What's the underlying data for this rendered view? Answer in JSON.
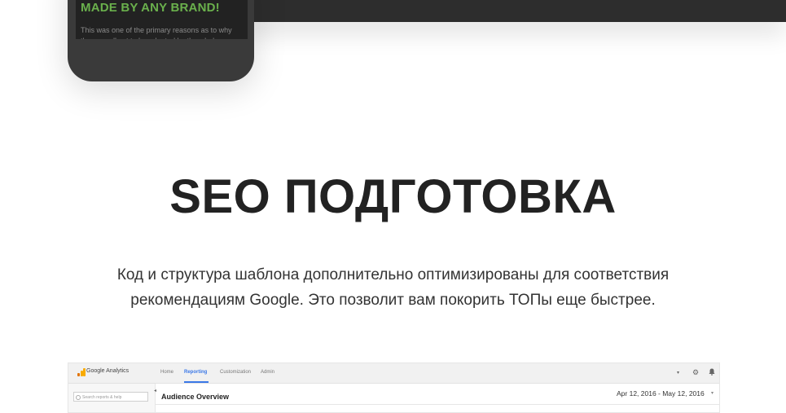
{
  "phone": {
    "headline": "MADE BY ANY BRAND!",
    "body": "This was one of the primary reasons as to why they are all set to be adopted by the whole"
  },
  "section": {
    "title": "SEO ПОДГОТОВКА",
    "text_line1": "Код и структура шаблона дополнительно оптимизированы для соответствия",
    "text_line2": "рекомендациям Google. Это позволит вам покорить ТОПы еще быстрее."
  },
  "ga": {
    "brand": "Google Analytics",
    "nav": [
      "Home",
      "Reporting",
      "Customization",
      "Admin"
    ],
    "active_nav": "Reporting",
    "search_placeholder": "Search reports & help",
    "heading": "Audience Overview",
    "date_range": "Apr 12, 2016 - May 12, 2016"
  },
  "colors": {
    "accent_green": "#6ab04c",
    "ga_blue": "#3b78e7",
    "ga_orange": "#f9ab00",
    "ga_dark_orange": "#e37400"
  }
}
